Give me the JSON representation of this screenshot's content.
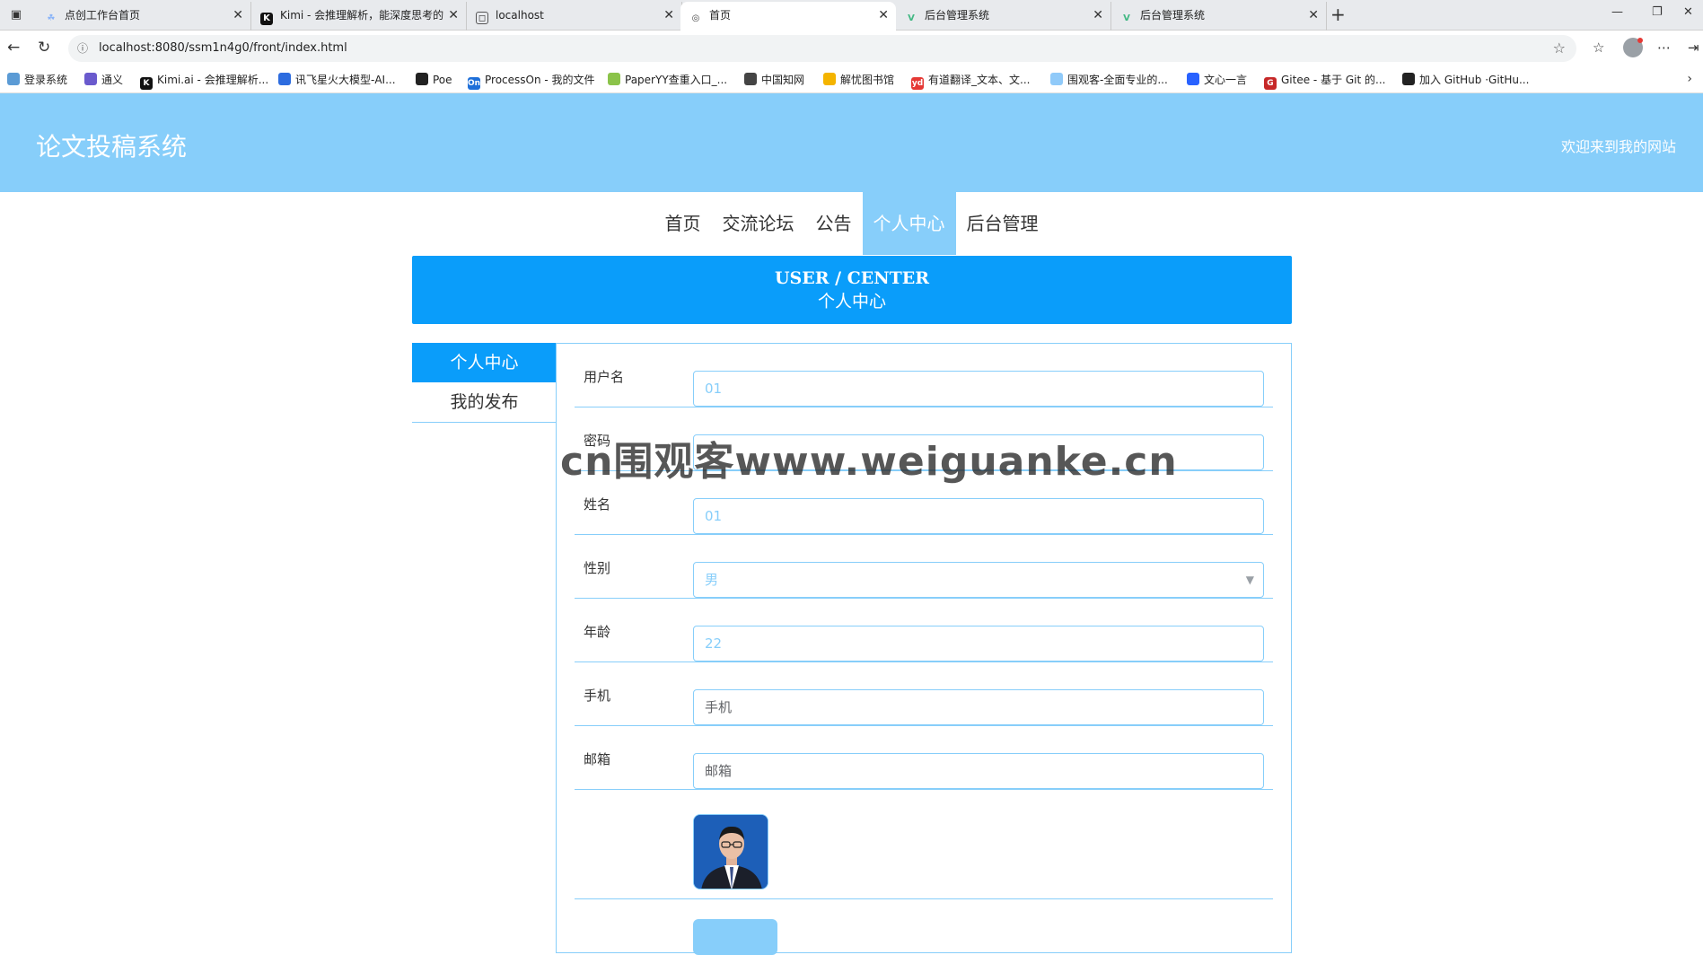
{
  "browser": {
    "tabs": [
      {
        "title": "点创工作台首页",
        "icon": "leaf-icon",
        "active": false
      },
      {
        "title": "Kimi - 会推理解析，能深度思考的",
        "icon": "kimi-icon",
        "active": false
      },
      {
        "title": "localhost",
        "icon": "page-icon",
        "active": false
      },
      {
        "title": "首页",
        "icon": "globe-icon",
        "active": true
      },
      {
        "title": "后台管理系统",
        "icon": "vue-icon",
        "active": false
      },
      {
        "title": "后台管理系统",
        "icon": "vue-icon",
        "active": false
      }
    ],
    "url": "localhost:8080/ssm1n4g0/front/index.html",
    "bookmarks": [
      {
        "label": "登录系统",
        "color": "#5b9bd5"
      },
      {
        "label": "通义",
        "color": "#6a5acd"
      },
      {
        "label": "Kimi.ai - 会推理解析...",
        "color": "#111111"
      },
      {
        "label": "讯飞星火大模型-AI...",
        "color": "#2d6cdf"
      },
      {
        "label": "Poe",
        "color": "#222222"
      },
      {
        "label": "ProcessOn - 我的文件",
        "color": "#1e6fd9"
      },
      {
        "label": "PaperYY查重入口_...",
        "color": "#8bc34a"
      },
      {
        "label": "中国知网",
        "color": "#444444"
      },
      {
        "label": "解忧图书馆",
        "color": "#f4b400"
      },
      {
        "label": "有道翻译_文本、文...",
        "color": "#e53935"
      },
      {
        "label": "围观客-全面专业的...",
        "color": "#90caf9"
      },
      {
        "label": "文心一言",
        "color": "#2962ff"
      },
      {
        "label": "Gitee - 基于 Git 的...",
        "color": "#c62828"
      },
      {
        "label": "加入 GitHub ·GitHu...",
        "color": "#222222"
      }
    ]
  },
  "site": {
    "title": "论文投稿系统",
    "welcome": "欢迎来到我的网站"
  },
  "nav": {
    "items": [
      "首页",
      "交流论坛",
      "公告",
      "个人中心",
      "后台管理"
    ],
    "active_index": 3
  },
  "banner": {
    "en": "USER / CENTER",
    "cn": "个人中心"
  },
  "side_menu": {
    "items": [
      "个人中心",
      "我的发布"
    ],
    "active_index": 0
  },
  "form": {
    "username": {
      "label": "用户名",
      "value": "01"
    },
    "password": {
      "label": "密码",
      "value": ""
    },
    "name": {
      "label": "姓名",
      "value": "01"
    },
    "gender": {
      "label": "性别",
      "value": "男"
    },
    "age": {
      "label": "年龄",
      "value": "22"
    },
    "phone": {
      "label": "手机",
      "placeholder": "手机"
    },
    "email": {
      "label": "邮箱",
      "placeholder": "邮箱"
    }
  },
  "watermark": "cn围观客www.weiguanke.cn"
}
